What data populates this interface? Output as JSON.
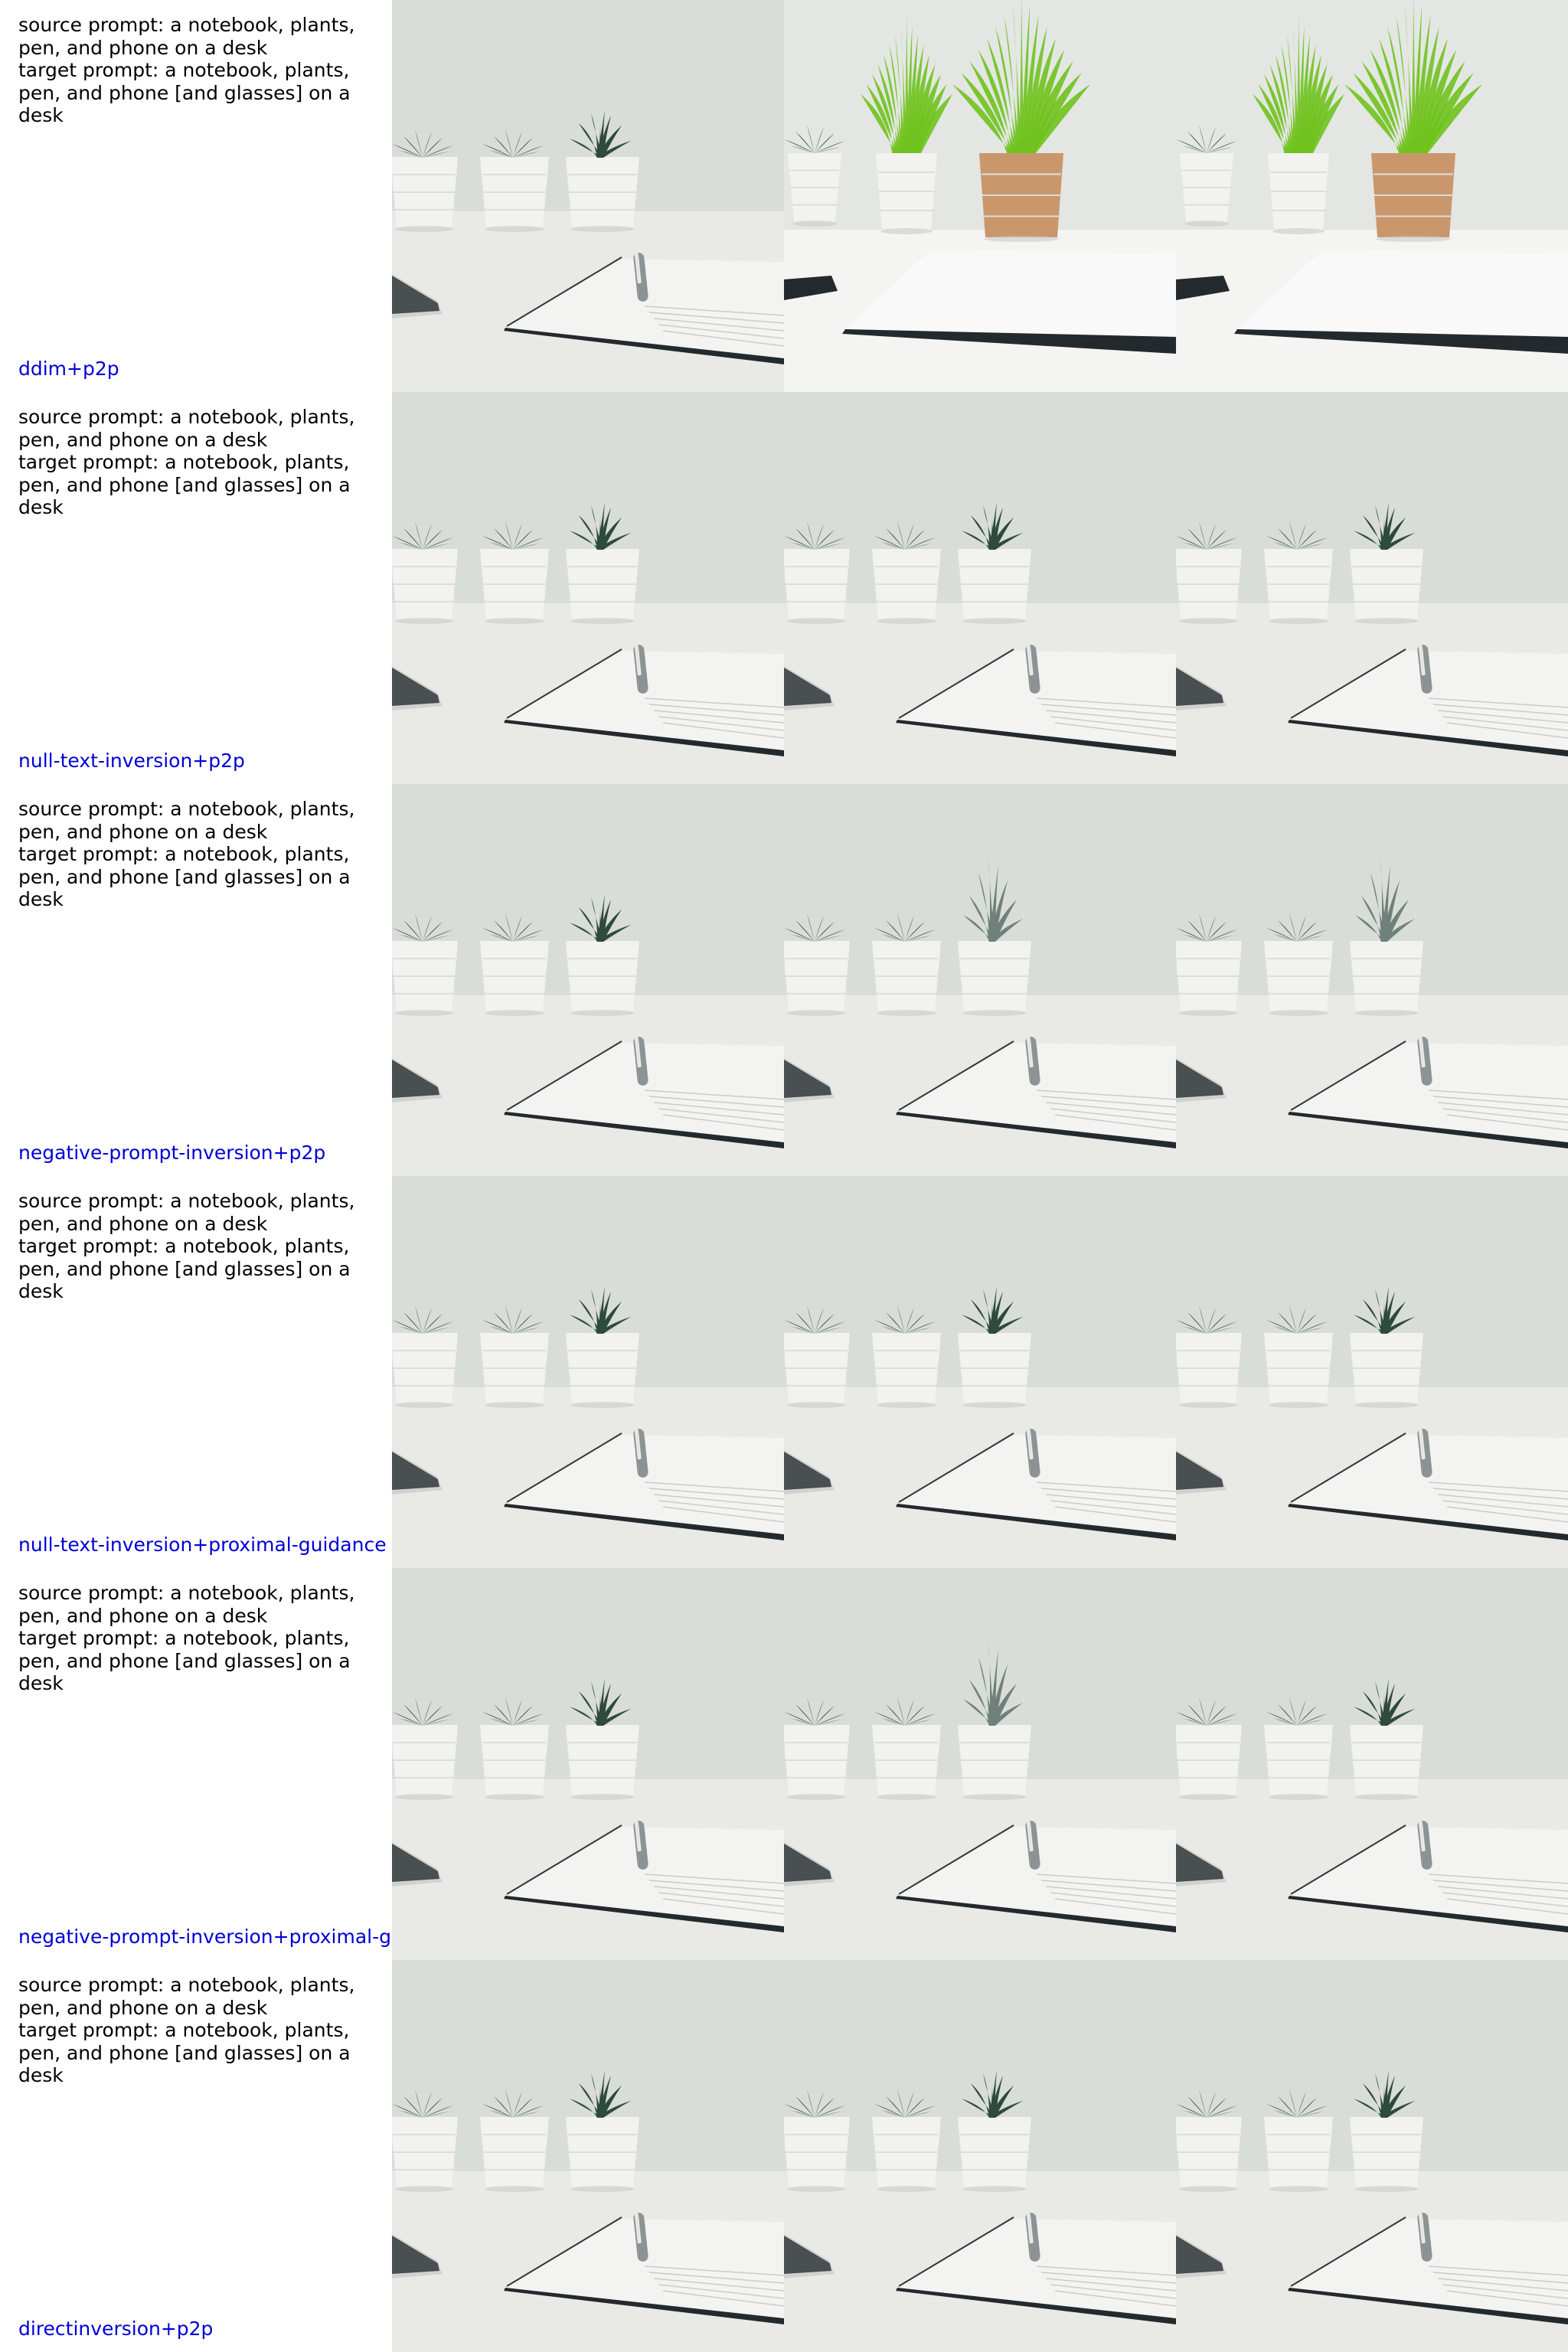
{
  "rows": [
    {
      "source_prompt": "source prompt: a notebook, plants, pen, and phone on a desk",
      "target_prompt": "target prompt: a notebook, plants, pen, and phone [and glasses] on a desk",
      "method": "ddim+p2p"
    },
    {
      "source_prompt": "source prompt: a notebook, plants, pen, and phone on a desk",
      "target_prompt": "target prompt: a notebook, plants, pen, and phone [and glasses] on a desk",
      "method": "null-text-inversion+p2p"
    },
    {
      "source_prompt": "source prompt: a notebook, plants, pen, and phone on a desk",
      "target_prompt": "target prompt: a notebook, plants, pen, and phone [and glasses] on a desk",
      "method": "negative-prompt-inversion+p2p"
    },
    {
      "source_prompt": "source prompt: a notebook, plants, pen, and phone on a desk",
      "target_prompt": "target prompt: a notebook, plants, pen, and phone [and glasses] on a desk",
      "method": "null-text-inversion+proximal-guidance"
    },
    {
      "source_prompt": "source prompt: a notebook, plants, pen, and phone on a desk",
      "target_prompt": "target prompt: a notebook, plants, pen, and phone [and glasses] on a desk",
      "method": "negative-prompt-inversion+proximal-g"
    },
    {
      "source_prompt": "source prompt: a notebook, plants, pen, and phone on a desk",
      "target_prompt": "target prompt: a notebook, plants, pen, and phone [and glasses] on a desk",
      "method": "directinversion+p2p"
    }
  ],
  "colors": {
    "method_label": "#0000d6",
    "prompt_text": "#000000",
    "wall": "#d9ddd8",
    "desk": "#e9eae6",
    "pot": "#f2f2f0",
    "succulent": "#2f4a3e",
    "grass_green": "#6fc21d",
    "terracotta_pot": "#c9976b",
    "notebook_cover": "#23292c"
  },
  "image_styles": [
    [
      "source",
      "ddim_blurry_grass",
      "ddim_blurry_grass"
    ],
    [
      "source",
      "source",
      "source"
    ],
    [
      "source",
      "tall_leaf",
      "tall_leaf"
    ],
    [
      "source",
      "source",
      "source"
    ],
    [
      "source",
      "tall_leaf",
      "source"
    ],
    [
      "source",
      "source",
      "source"
    ]
  ]
}
